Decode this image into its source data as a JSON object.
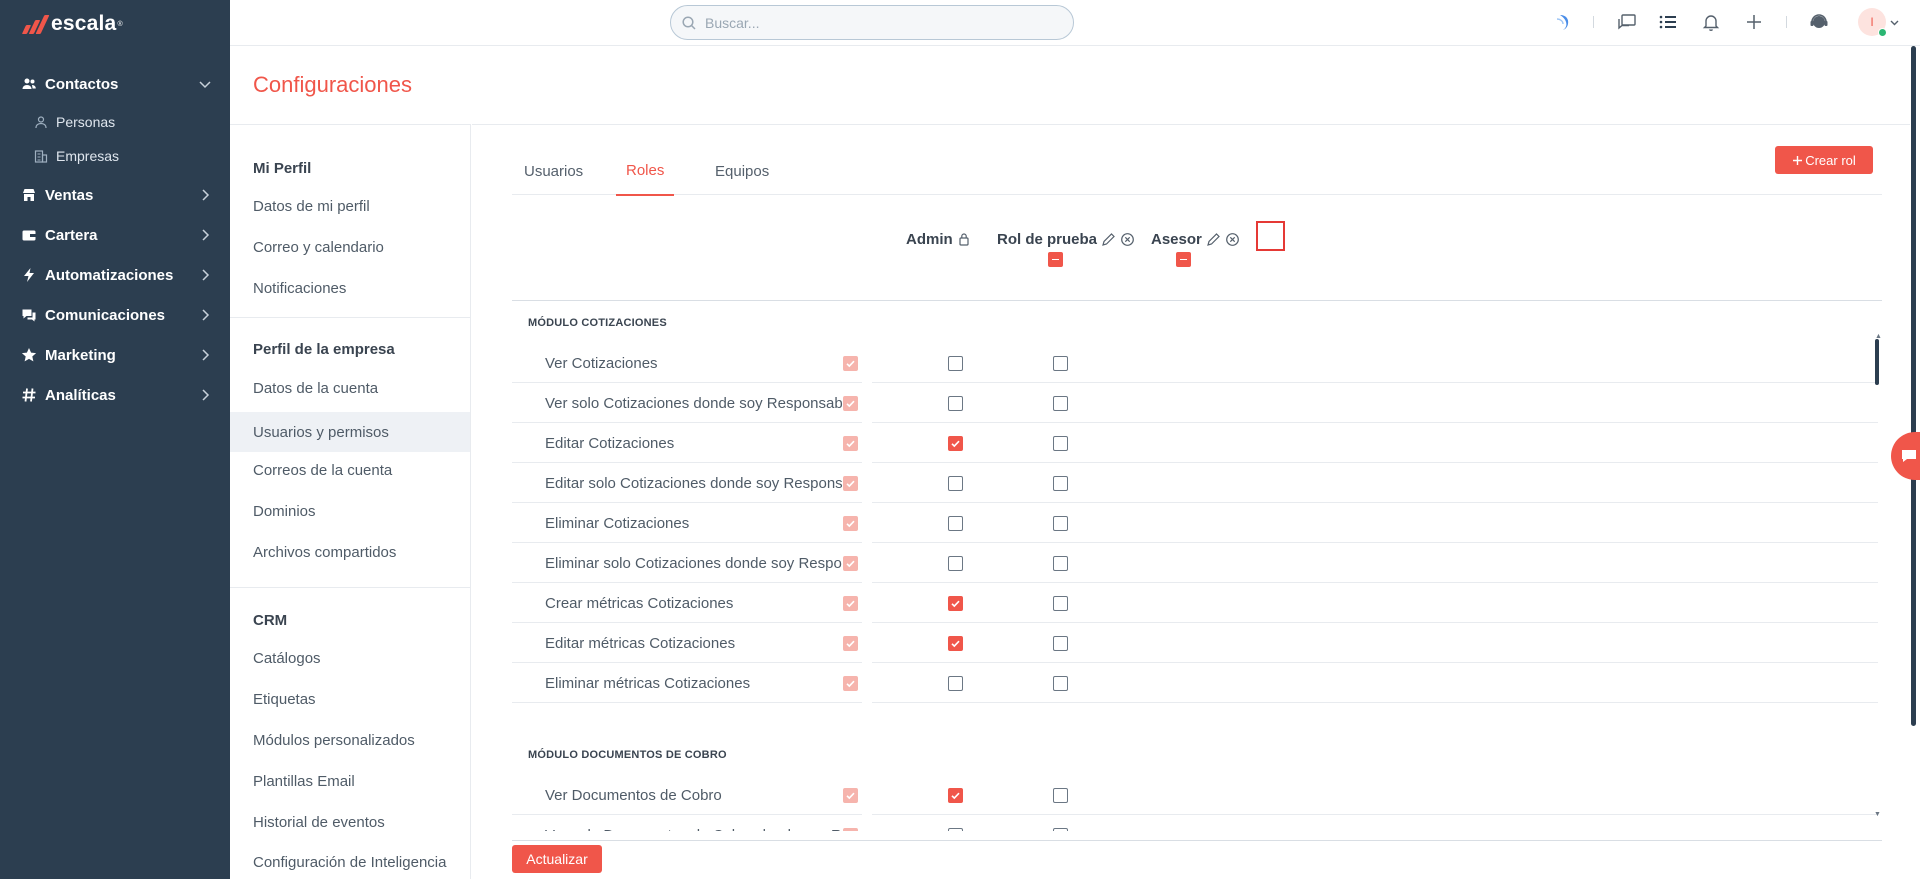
{
  "app": {
    "logo_text": "escala",
    "logo_tm": "®"
  },
  "sidebar": {
    "items": [
      {
        "label": "Contactos",
        "icon": "users-icon"
      },
      {
        "label": "Ventas",
        "icon": "store-icon"
      },
      {
        "label": "Cartera",
        "icon": "wallet-icon"
      },
      {
        "label": "Automatizaciones",
        "icon": "bolt-icon"
      },
      {
        "label": "Comunicaciones",
        "icon": "chat-icon"
      },
      {
        "label": "Marketing",
        "icon": "star-icon"
      },
      {
        "label": "Analíticas",
        "icon": "hash-icon"
      }
    ],
    "subitems": [
      {
        "label": "Personas",
        "icon": "person-icon"
      },
      {
        "label": "Empresas",
        "icon": "building-icon"
      }
    ]
  },
  "topbar": {
    "search_placeholder": "Buscar...",
    "avatar_initial": "I"
  },
  "page": {
    "title": "Configuraciones"
  },
  "settings_menu": {
    "sections": [
      {
        "title": "Mi Perfil",
        "items": [
          "Datos de mi perfil",
          "Correo y calendario",
          "Notificaciones"
        ]
      },
      {
        "title": "Perfil de la empresa",
        "items": [
          "Datos de la cuenta",
          "Usuarios y permisos",
          "Correos de la cuenta",
          "Dominios",
          "Archivos compartidos"
        ]
      },
      {
        "title": "CRM",
        "items": [
          "Catálogos",
          "Etiquetas",
          "Módulos personalizados",
          "Plantillas Email",
          "Historial de eventos",
          "Configuración de Inteligencia"
        ]
      }
    ],
    "active": "Usuarios y permisos"
  },
  "tabs": [
    {
      "label": "Usuarios",
      "active": false
    },
    {
      "label": "Roles",
      "active": true
    },
    {
      "label": "Equipos",
      "active": false
    }
  ],
  "create_role_label": "Crear rol",
  "roles": [
    {
      "name": "Admin",
      "locked": true
    },
    {
      "name": "Rol de prueba",
      "locked": false
    },
    {
      "name": "Asesor",
      "locked": false
    }
  ],
  "modules": [
    {
      "title": "MÓDULO COTIZACIONES",
      "permissions": [
        {
          "label": "Ver Cotizaciones",
          "values": [
            "disabled",
            false,
            false
          ]
        },
        {
          "label": "Ver solo Cotizaciones donde soy Responsable",
          "values": [
            "disabled",
            false,
            false
          ]
        },
        {
          "label": "Editar Cotizaciones",
          "values": [
            "disabled",
            true,
            false
          ]
        },
        {
          "label": "Editar solo Cotizaciones donde soy Responsable",
          "values": [
            "disabled",
            false,
            false
          ]
        },
        {
          "label": "Eliminar Cotizaciones",
          "values": [
            "disabled",
            false,
            false
          ]
        },
        {
          "label": "Eliminar solo Cotizaciones donde soy Responsable",
          "values": [
            "disabled",
            false,
            false
          ]
        },
        {
          "label": "Crear métricas Cotizaciones",
          "values": [
            "disabled",
            true,
            false
          ]
        },
        {
          "label": "Editar métricas Cotizaciones",
          "values": [
            "disabled",
            true,
            false
          ]
        },
        {
          "label": "Eliminar métricas Cotizaciones",
          "values": [
            "disabled",
            false,
            false
          ]
        }
      ]
    },
    {
      "title": "MÓDULO DOCUMENTOS DE COBRO",
      "permissions": [
        {
          "label": "Ver Documentos de Cobro",
          "values": [
            "disabled",
            true,
            false
          ]
        },
        {
          "label": "Ver solo Documentos de Cobro donde soy Responsable",
          "values": [
            "disabled",
            false,
            false
          ]
        }
      ]
    }
  ],
  "update_label": "Actualizar",
  "colors": {
    "brand": "#f0564a",
    "sidebar": "#2c3e50"
  }
}
